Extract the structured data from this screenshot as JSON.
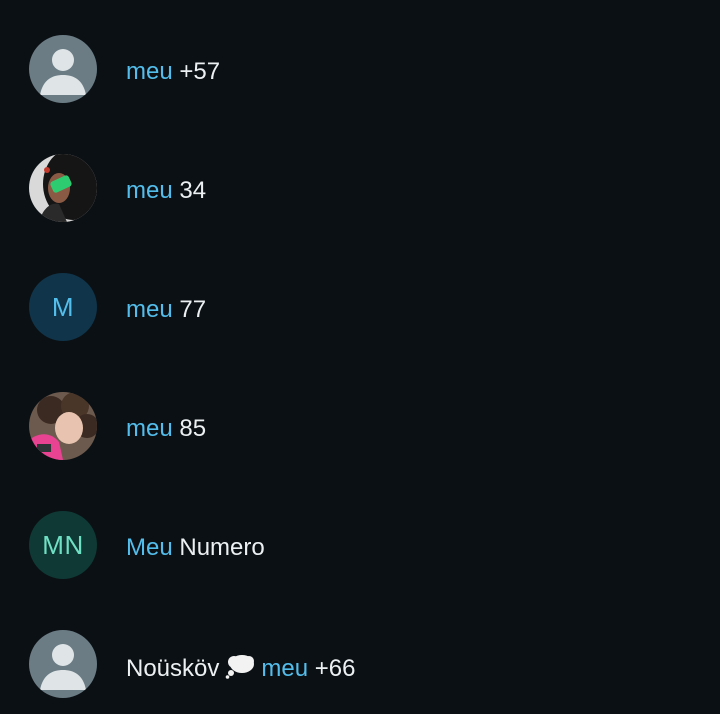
{
  "contacts": [
    {
      "avatar": "default-person-icon",
      "name_highlight": "meu",
      "name_rest": " +57"
    },
    {
      "avatar": "photo",
      "name_highlight": "meu",
      "name_rest": " 34"
    },
    {
      "avatar": "initials",
      "initials": "M",
      "initials_color": "#53bdeb",
      "avatar_bg": "#103449",
      "name_highlight": "meu",
      "name_rest": " 77"
    },
    {
      "avatar": "photo",
      "name_highlight": "meu",
      "name_rest": " 85"
    },
    {
      "avatar": "initials",
      "initials": "MN",
      "initials_color": "#6fe0c4",
      "avatar_bg": "#0f3934",
      "name_highlight": "Meu",
      "name_rest": " Numero"
    },
    {
      "avatar": "default-person-icon",
      "name_prefix": "Noüsköv",
      "name_emoji": "thought-balloon-icon",
      "name_highlight": "meu",
      "name_rest": " +66"
    }
  ],
  "colors": {
    "background": "#0b1014",
    "highlight": "#53bdeb",
    "text": "#ecf0f2",
    "default_avatar_bg": "#6b7c85",
    "default_avatar_fg": "#dfe5e7"
  }
}
